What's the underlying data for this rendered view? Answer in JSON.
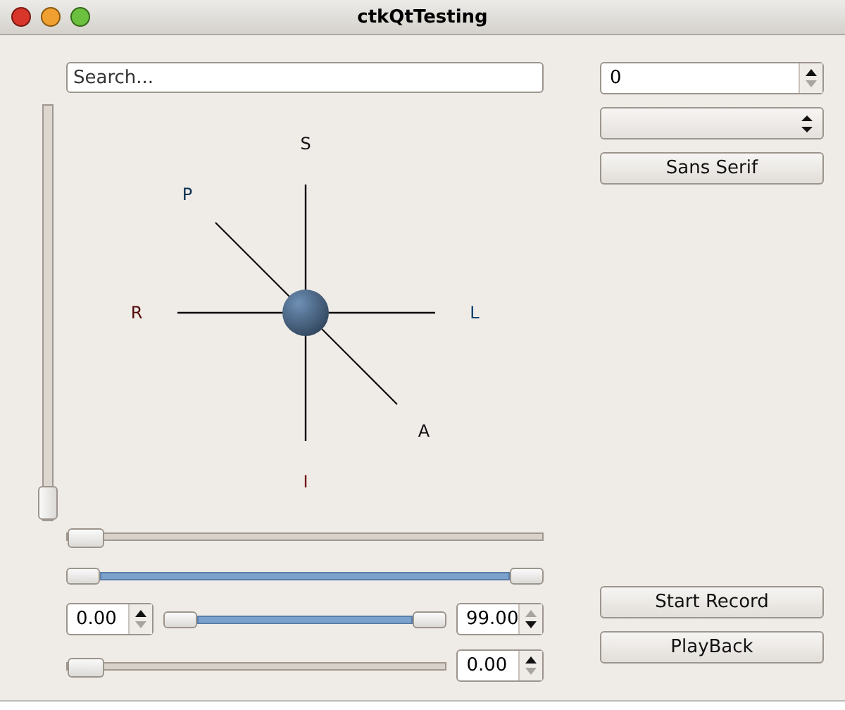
{
  "window": {
    "title": "ctkQtTesting"
  },
  "search": {
    "placeholder": "Search..."
  },
  "vertical_slider": {
    "level": 0
  },
  "orientation": {
    "labels": [
      {
        "text": "S",
        "color": "#101010"
      },
      {
        "text": "P",
        "color": "#0a3050"
      },
      {
        "text": "R",
        "color": "#500a0a"
      },
      {
        "text": "L",
        "color": "#0a4070"
      },
      {
        "text": "A",
        "color": "#101010"
      },
      {
        "text": "I",
        "color": "#700a0a"
      }
    ]
  },
  "spin_box": {
    "value": "0",
    "up_disabled": false,
    "down_disabled": true
  },
  "font_button": "Sans Serif",
  "slider": {
    "level": 0
  },
  "range_slider": {
    "lower": {
      "level": 0
    },
    "upper": {
      "level": 1
    }
  },
  "range_widget": {
    "min_spin": {
      "value": "0.00",
      "up_disabled": false,
      "down_disabled": true
    },
    "lower": {
      "level": 0
    },
    "upper": {
      "level": 1
    },
    "max_spin": {
      "value": "99.00",
      "up_disabled": true,
      "down_disabled": false
    }
  },
  "value_slider": {
    "level": 0,
    "spin": {
      "value": "0.00",
      "up_disabled": false,
      "down_disabled": true
    }
  },
  "buttons": [
    "Start Record",
    "PlayBack"
  ]
}
